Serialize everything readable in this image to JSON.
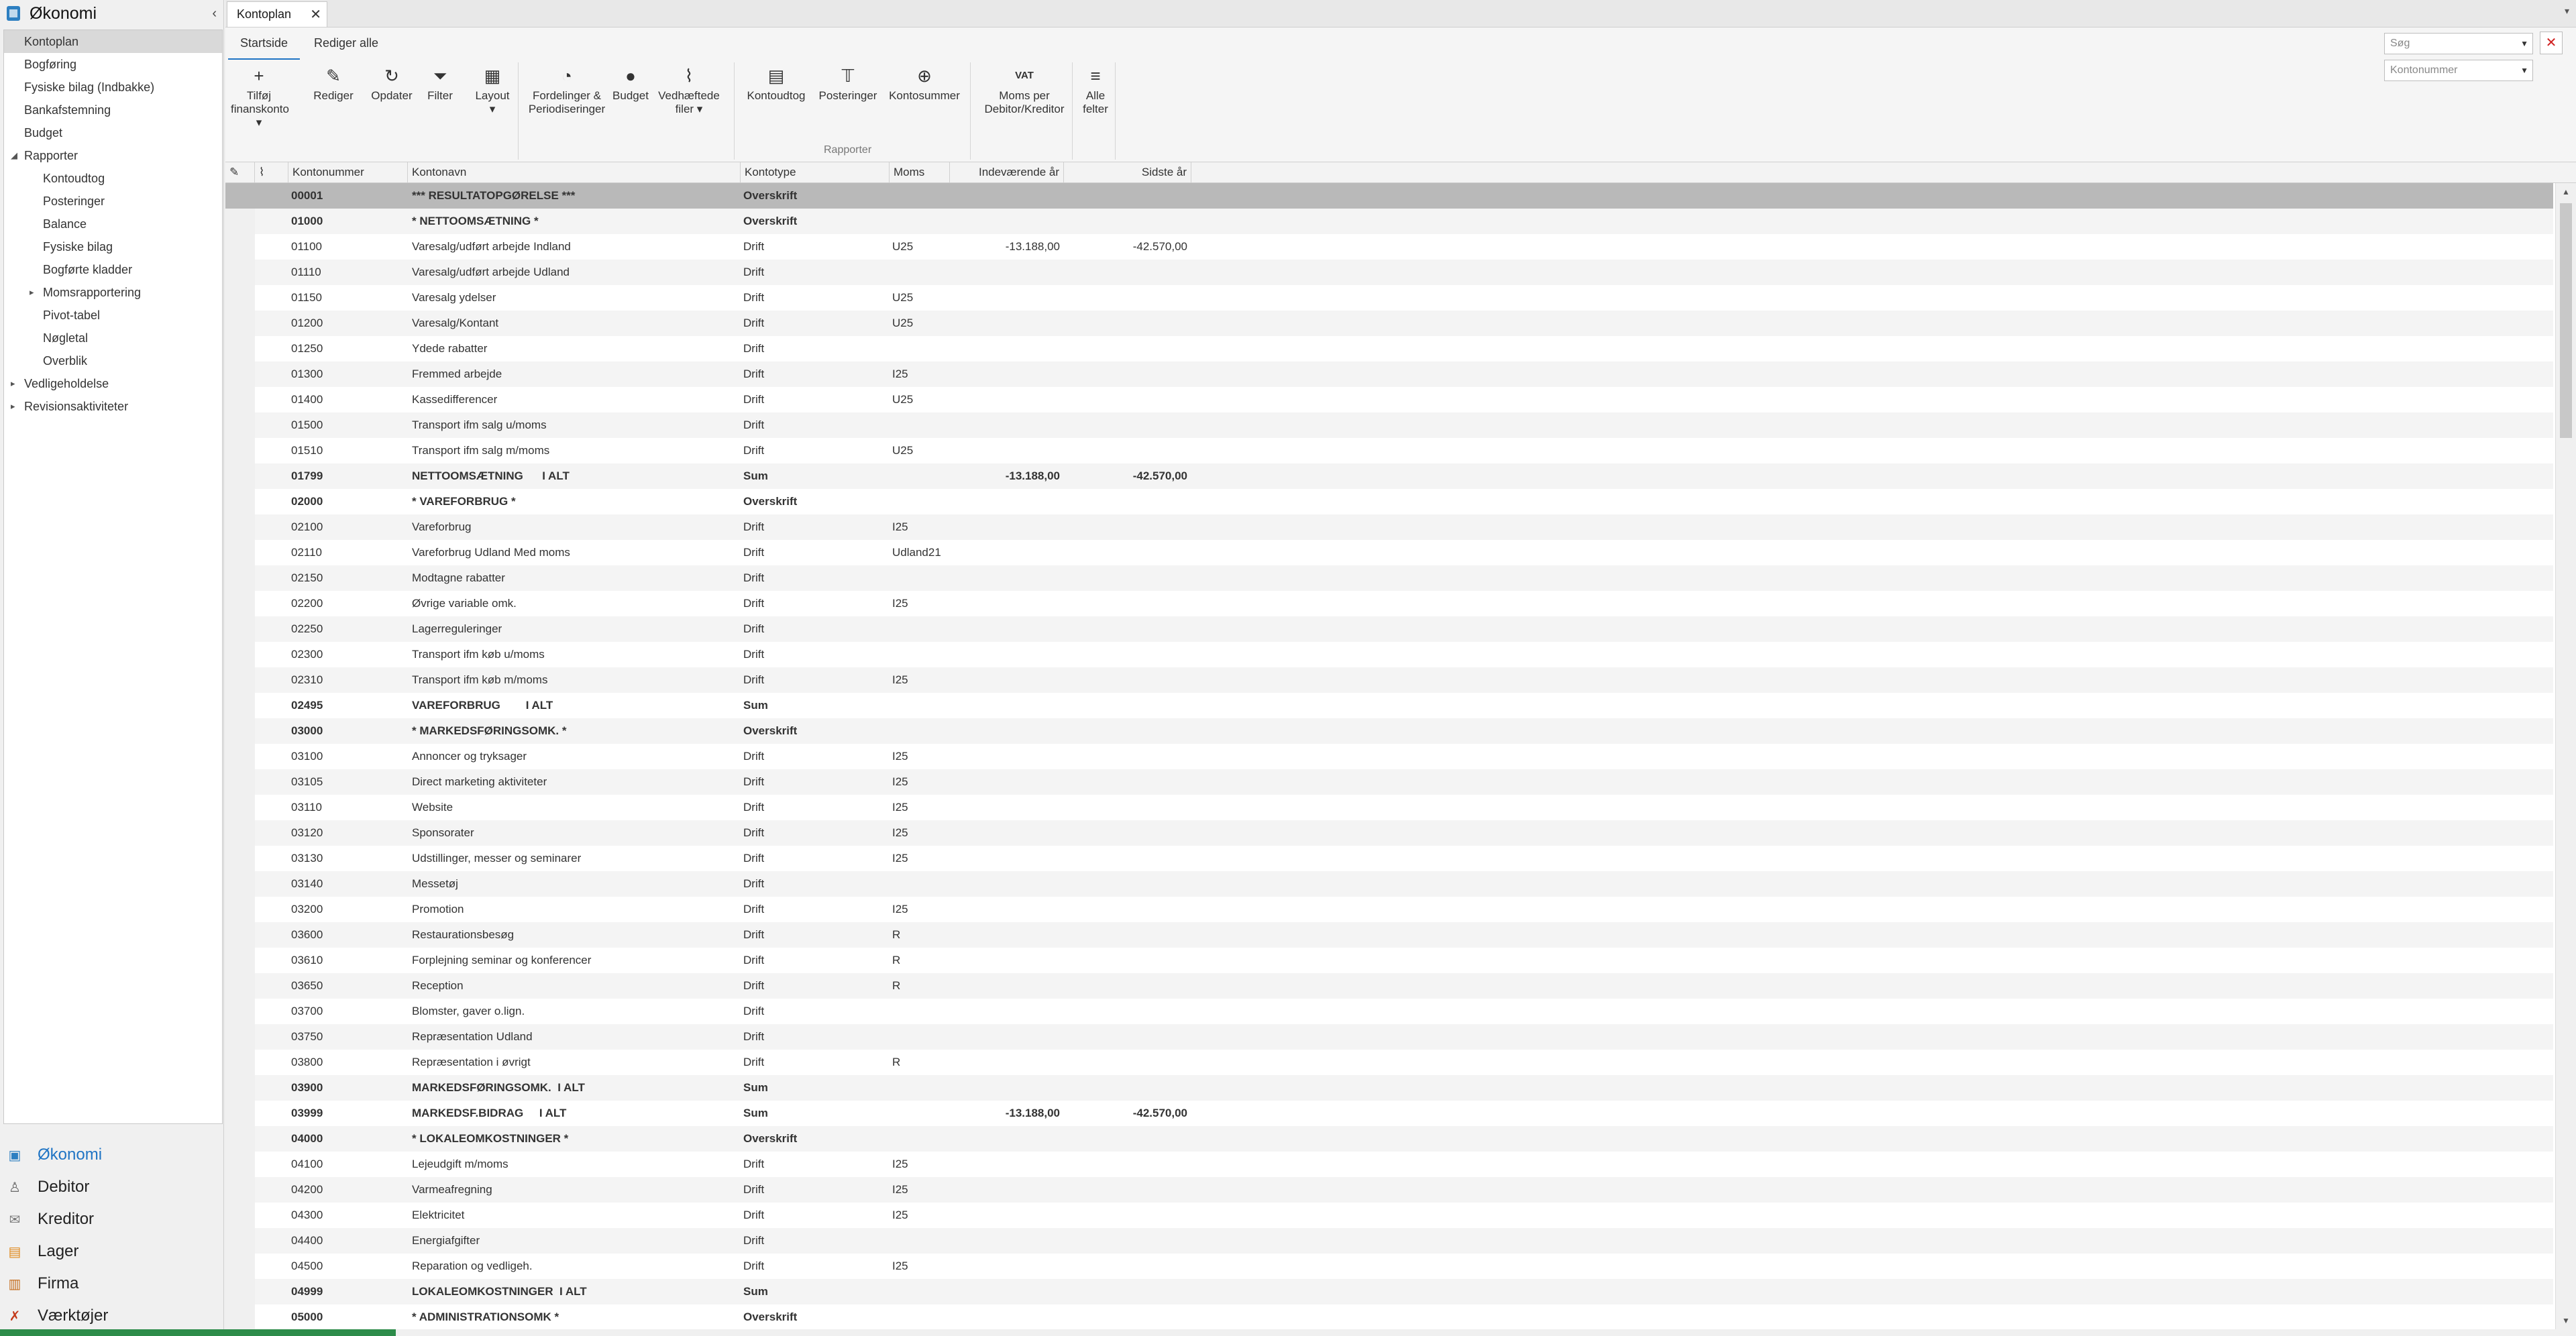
{
  "app": {
    "title": "Økonomi",
    "collapse_icon": "chevron-left-icon"
  },
  "tree": [
    {
      "label": "Kontoplan",
      "level": 0,
      "selected": true
    },
    {
      "label": "Bogføring",
      "level": 0
    },
    {
      "label": "Fysiske bilag (Indbakke)",
      "level": 0
    },
    {
      "label": "Bankafstemning",
      "level": 0
    },
    {
      "label": "Budget",
      "level": 0
    },
    {
      "label": "Rapporter",
      "level": 0,
      "expanded": true
    },
    {
      "label": "Kontoudtog",
      "level": 1
    },
    {
      "label": "Posteringer",
      "level": 1
    },
    {
      "label": "Balance",
      "level": 1
    },
    {
      "label": "Fysiske bilag",
      "level": 1
    },
    {
      "label": "Bogførte kladder",
      "level": 1
    },
    {
      "label": "Momsrapportering",
      "level": 1,
      "collapsed": true
    },
    {
      "label": "Pivot-tabel",
      "level": 1
    },
    {
      "label": "Nøgletal",
      "level": 1
    },
    {
      "label": "Overblik",
      "level": 1
    },
    {
      "label": "Vedligeholdelse",
      "level": 0,
      "collapsed": true
    },
    {
      "label": "Revisionsaktiviteter",
      "level": 0,
      "collapsed": true
    }
  ],
  "modules": [
    {
      "label": "Økonomi",
      "icon": "ledger-icon",
      "active": true
    },
    {
      "label": "Debitor",
      "icon": "person-icon"
    },
    {
      "label": "Kreditor",
      "icon": "invoice-icon"
    },
    {
      "label": "Lager",
      "icon": "box-icon"
    },
    {
      "label": "Firma",
      "icon": "building-icon"
    },
    {
      "label": "Værktøjer",
      "icon": "tools-icon"
    }
  ],
  "doc_tab": {
    "label": "Kontoplan"
  },
  "ribbon_tabs": [
    "Startside",
    "Rediger alle"
  ],
  "ribbon": {
    "buttons": [
      {
        "label": "Tilføj\nfinanskonto ▾",
        "icon": "plus-icon"
      },
      {
        "label": "Rediger",
        "icon": "pencil-icon"
      },
      {
        "label": "Opdater",
        "icon": "refresh-icon"
      },
      {
        "label": "Filter",
        "icon": "filter-icon"
      },
      {
        "label": "Layout\n▾",
        "icon": "layout-icon"
      },
      {
        "label": "Fordelinger &\nPeriodiseringer",
        "icon": "pie-icon"
      },
      {
        "label": "Budget",
        "icon": "moneybag-icon"
      },
      {
        "label": "Vedhæftede\nfiler ▾",
        "icon": "paperclip-icon"
      },
      {
        "label": "Kontoudtog",
        "icon": "statement-icon"
      },
      {
        "label": "Posteringer",
        "icon": "postings-icon"
      },
      {
        "label": "Kontosummer",
        "icon": "zoom-sum-icon"
      },
      {
        "label": "Moms per\nDebitor/Kreditor",
        "icon": "vat-icon"
      },
      {
        "label": "Alle\nfelter",
        "icon": "menu-icon"
      }
    ],
    "group_label": "Rapporter",
    "vat_text": "VAT",
    "search_placeholder": "Søg",
    "sort_field": "Kontonummer"
  },
  "columns": [
    "Kontonummer",
    "Kontonavn",
    "Kontotype",
    "Moms",
    "Indeværende år",
    "Sidste år"
  ],
  "rows": [
    {
      "no": "00001",
      "name": "*** RESULTATOPGØRELSE ***",
      "type": "Overskrift",
      "moms": "",
      "cur": "",
      "last": "",
      "bold": true,
      "selected": true
    },
    {
      "no": "01000",
      "name": "* NETTOOMSÆTNING *",
      "type": "Overskrift",
      "moms": "",
      "cur": "",
      "last": "",
      "bold": true
    },
    {
      "no": "01100",
      "name": "Varesalg/udført arbejde Indland",
      "type": "Drift",
      "moms": "U25",
      "cur": "-13.188,00",
      "last": "-42.570,00"
    },
    {
      "no": "01110",
      "name": "Varesalg/udført arbejde Udland",
      "type": "Drift",
      "moms": "",
      "cur": "",
      "last": ""
    },
    {
      "no": "01150",
      "name": "Varesalg ydelser",
      "type": "Drift",
      "moms": "U25",
      "cur": "",
      "last": ""
    },
    {
      "no": "01200",
      "name": "Varesalg/Kontant",
      "type": "Drift",
      "moms": "U25",
      "cur": "",
      "last": ""
    },
    {
      "no": "01250",
      "name": "Ydede rabatter",
      "type": "Drift",
      "moms": "",
      "cur": "",
      "last": ""
    },
    {
      "no": "01300",
      "name": "Fremmed arbejde",
      "type": "Drift",
      "moms": "I25",
      "cur": "",
      "last": ""
    },
    {
      "no": "01400",
      "name": "Kassedifferencer",
      "type": "Drift",
      "moms": "U25",
      "cur": "",
      "last": ""
    },
    {
      "no": "01500",
      "name": "Transport ifm salg u/moms",
      "type": "Drift",
      "moms": "",
      "cur": "",
      "last": ""
    },
    {
      "no": "01510",
      "name": "Transport ifm salg m/moms",
      "type": "Drift",
      "moms": "U25",
      "cur": "",
      "last": ""
    },
    {
      "no": "01799",
      "name": "NETTOOMSÆTNING      I ALT",
      "type": "Sum",
      "moms": "",
      "cur": "-13.188,00",
      "last": "-42.570,00",
      "bold": true
    },
    {
      "no": "02000",
      "name": "* VAREFORBRUG *",
      "type": "Overskrift",
      "moms": "",
      "cur": "",
      "last": "",
      "bold": true
    },
    {
      "no": "02100",
      "name": "Vareforbrug",
      "type": "Drift",
      "moms": "I25",
      "cur": "",
      "last": ""
    },
    {
      "no": "02110",
      "name": "Vareforbrug Udland Med moms",
      "type": "Drift",
      "moms": "Udland21",
      "cur": "",
      "last": ""
    },
    {
      "no": "02150",
      "name": "Modtagne rabatter",
      "type": "Drift",
      "moms": "",
      "cur": "",
      "last": ""
    },
    {
      "no": "02200",
      "name": "Øvrige variable omk.",
      "type": "Drift",
      "moms": "I25",
      "cur": "",
      "last": ""
    },
    {
      "no": "02250",
      "name": "Lagerreguleringer",
      "type": "Drift",
      "moms": "",
      "cur": "",
      "last": ""
    },
    {
      "no": "02300",
      "name": "Transport ifm køb u/moms",
      "type": "Drift",
      "moms": "",
      "cur": "",
      "last": ""
    },
    {
      "no": "02310",
      "name": "Transport ifm køb m/moms",
      "type": "Drift",
      "moms": "I25",
      "cur": "",
      "last": ""
    },
    {
      "no": "02495",
      "name": "VAREFORBRUG        I ALT",
      "type": "Sum",
      "moms": "",
      "cur": "",
      "last": "",
      "bold": true
    },
    {
      "no": "03000",
      "name": "* MARKEDSFØRINGSOMK. *",
      "type": "Overskrift",
      "moms": "",
      "cur": "",
      "last": "",
      "bold": true
    },
    {
      "no": "03100",
      "name": "Annoncer og tryksager",
      "type": "Drift",
      "moms": "I25",
      "cur": "",
      "last": ""
    },
    {
      "no": "03105",
      "name": "Direct marketing aktiviteter",
      "type": "Drift",
      "moms": "I25",
      "cur": "",
      "last": ""
    },
    {
      "no": "03110",
      "name": "Website",
      "type": "Drift",
      "moms": "I25",
      "cur": "",
      "last": ""
    },
    {
      "no": "03120",
      "name": "Sponsorater",
      "type": "Drift",
      "moms": "I25",
      "cur": "",
      "last": ""
    },
    {
      "no": "03130",
      "name": "Udstillinger, messer og seminarer",
      "type": "Drift",
      "moms": "I25",
      "cur": "",
      "last": ""
    },
    {
      "no": "03140",
      "name": "Messetøj",
      "type": "Drift",
      "moms": "",
      "cur": "",
      "last": ""
    },
    {
      "no": "03200",
      "name": "Promotion",
      "type": "Drift",
      "moms": "I25",
      "cur": "",
      "last": ""
    },
    {
      "no": "03600",
      "name": "Restaurationsbesøg",
      "type": "Drift",
      "moms": "R",
      "cur": "",
      "last": ""
    },
    {
      "no": "03610",
      "name": "Forplejning seminar og konferencer",
      "type": "Drift",
      "moms": "R",
      "cur": "",
      "last": ""
    },
    {
      "no": "03650",
      "name": "Reception",
      "type": "Drift",
      "moms": "R",
      "cur": "",
      "last": ""
    },
    {
      "no": "03700",
      "name": "Blomster, gaver o.lign.",
      "type": "Drift",
      "moms": "",
      "cur": "",
      "last": ""
    },
    {
      "no": "03750",
      "name": "Repræsentation Udland",
      "type": "Drift",
      "moms": "",
      "cur": "",
      "last": ""
    },
    {
      "no": "03800",
      "name": "Repræsentation i øvrigt",
      "type": "Drift",
      "moms": "R",
      "cur": "",
      "last": ""
    },
    {
      "no": "03900",
      "name": "MARKEDSFØRINGSOMK.  I ALT",
      "type": "Sum",
      "moms": "",
      "cur": "",
      "last": "",
      "bold": true
    },
    {
      "no": "03999",
      "name": "MARKEDSF.BIDRAG     I ALT",
      "type": "Sum",
      "moms": "",
      "cur": "-13.188,00",
      "last": "-42.570,00",
      "bold": true
    },
    {
      "no": "04000",
      "name": "* LOKALEOMKOSTNINGER *",
      "type": "Overskrift",
      "moms": "",
      "cur": "",
      "last": "",
      "bold": true
    },
    {
      "no": "04100",
      "name": "Lejeudgift m/moms",
      "type": "Drift",
      "moms": "I25",
      "cur": "",
      "last": ""
    },
    {
      "no": "04200",
      "name": "Varmeafregning",
      "type": "Drift",
      "moms": "I25",
      "cur": "",
      "last": ""
    },
    {
      "no": "04300",
      "name": "Elektricitet",
      "type": "Drift",
      "moms": "I25",
      "cur": "",
      "last": ""
    },
    {
      "no": "04400",
      "name": "Energiafgifter",
      "type": "Drift",
      "moms": "",
      "cur": "",
      "last": ""
    },
    {
      "no": "04500",
      "name": "Reparation og vedligeh.",
      "type": "Drift",
      "moms": "I25",
      "cur": "",
      "last": ""
    },
    {
      "no": "04999",
      "name": "LOKALEOMKOSTNINGER  I ALT",
      "type": "Sum",
      "moms": "",
      "cur": "",
      "last": "",
      "bold": true
    },
    {
      "no": "05000",
      "name": "* ADMINISTRATIONSOMK *",
      "type": "Overskrift",
      "moms": "",
      "cur": "",
      "last": "",
      "bold": true
    }
  ],
  "colors": {
    "accent": "#1f74c4",
    "selected_row": "#b9b9b9",
    "alt_row": "#f4f4f4"
  }
}
